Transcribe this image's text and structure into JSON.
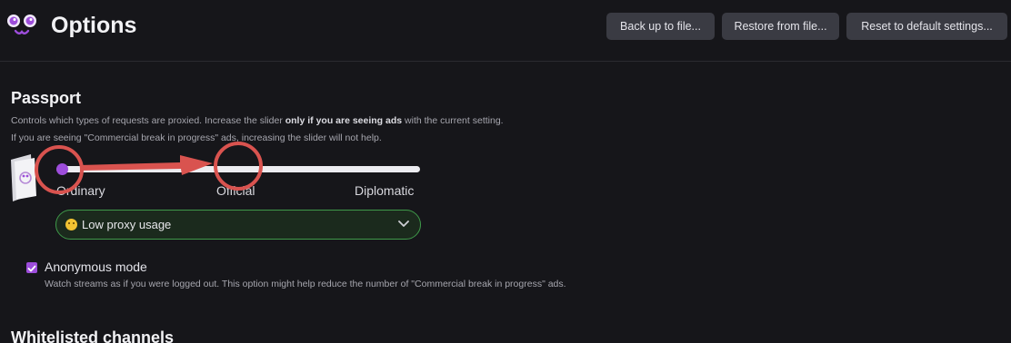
{
  "header": {
    "title": "Options",
    "buttons": {
      "backup": "Back up to file...",
      "restore": "Restore from file...",
      "reset": "Reset to default settings..."
    }
  },
  "passport": {
    "title": "Passport",
    "description_1_prefix": "Controls which types of requests are proxied. Increase the slider ",
    "description_1_bold": "only if you are seeing ads",
    "description_1_suffix": " with the current setting.",
    "description_2": "If you are seeing \"Commercial break in progress\" ads, increasing the slider will not help.",
    "slider": {
      "labels": [
        "Ordinary",
        "Official",
        "Diplomatic"
      ],
      "current_level": "Ordinary"
    },
    "dropdown": {
      "selected": "Low proxy usage",
      "icon": "smiley-icon"
    }
  },
  "anonymous_mode": {
    "label": "Anonymous mode",
    "checked": true,
    "description": "Watch streams as if you were logged out. This option might help reduce the number of \"Commercial break in progress\" ads."
  },
  "whitelist": {
    "title": "Whitelisted channels"
  },
  "colors": {
    "background": "#16161a",
    "accent_purple": "#9d4ddb",
    "annotation_red": "#d9534f",
    "select_border_green": "#3f9a4a"
  }
}
